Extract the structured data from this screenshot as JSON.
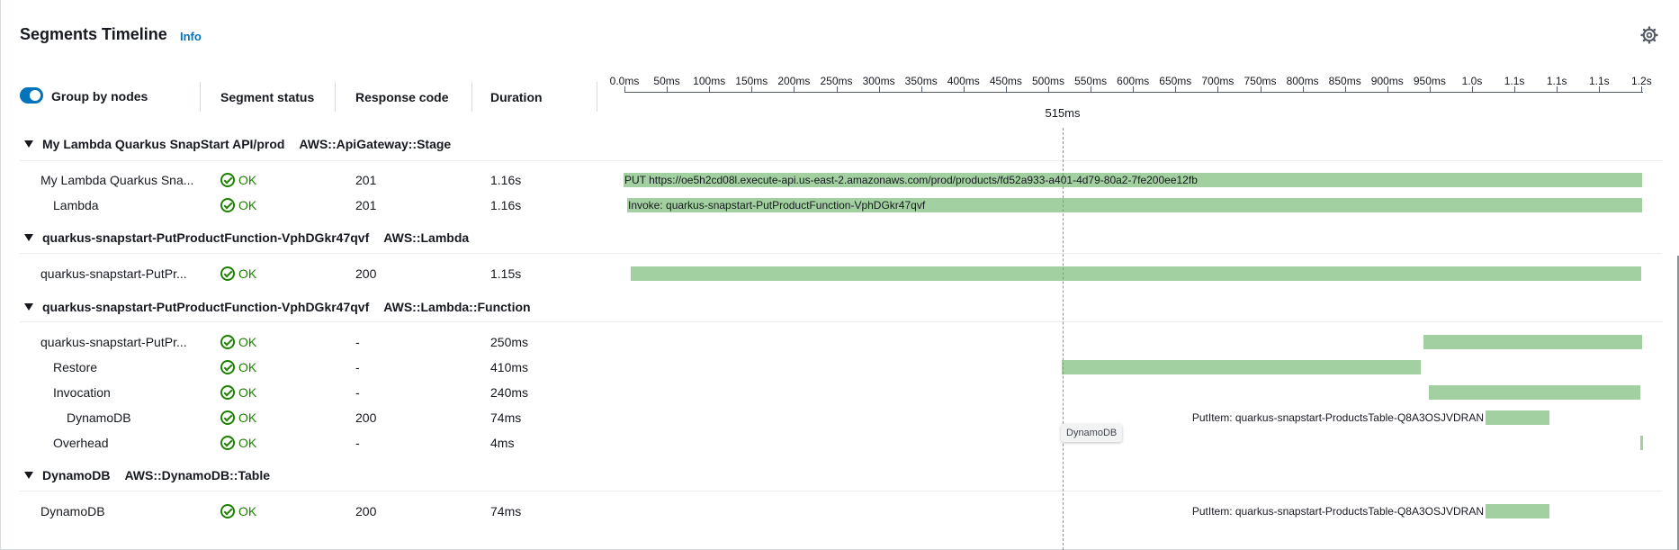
{
  "panel": {
    "title": "Segments Timeline",
    "info_label": "Info",
    "settings_icon": "gear-icon"
  },
  "controls": {
    "group_by_nodes_label": "Group by nodes",
    "group_by_nodes_enabled": true
  },
  "columns": {
    "status": "Segment status",
    "response_code": "Response code",
    "duration": "Duration"
  },
  "axis": {
    "ticks": [
      "0.0ms",
      "50ms",
      "100ms",
      "150ms",
      "200ms",
      "250ms",
      "300ms",
      "350ms",
      "400ms",
      "450ms",
      "500ms",
      "550ms",
      "600ms",
      "650ms",
      "700ms",
      "750ms",
      "800ms",
      "850ms",
      "900ms",
      "950ms",
      "1.0s",
      "1.1s",
      "1.1s",
      "1.1s",
      "1.2s"
    ],
    "cursor_label": "515ms"
  },
  "groups": [
    {
      "name": "My Lambda Quarkus SnapStart API/prod",
      "type": "AWS::ApiGateway::Stage",
      "rows": [
        {
          "name": "My Lambda Quarkus Sna...",
          "status": "OK",
          "code": "201",
          "duration": "1.16s",
          "bar_label": "PUT https://oe5h2cd08l.execute-api.us-east-2.amazonaws.com/prod/products/fd52a933-a401-4d79-80a2-7fe200ee12fb"
        },
        {
          "name": "Lambda",
          "status": "OK",
          "code": "201",
          "duration": "1.16s",
          "bar_label": "Invoke: quarkus-snapstart-PutProductFunction-VphDGkr47qvf"
        }
      ]
    },
    {
      "name": "quarkus-snapstart-PutProductFunction-VphDGkr47qvf",
      "type": "AWS::Lambda",
      "rows": [
        {
          "name": "quarkus-snapstart-PutPr...",
          "status": "OK",
          "code": "200",
          "duration": "1.15s",
          "bar_label": ""
        }
      ]
    },
    {
      "name": "quarkus-snapstart-PutProductFunction-VphDGkr47qvf",
      "type": "AWS::Lambda::Function",
      "rows": [
        {
          "name": "quarkus-snapstart-PutPr...",
          "status": "OK",
          "code": "-",
          "duration": "250ms",
          "bar_label": ""
        },
        {
          "name": "Restore",
          "status": "OK",
          "code": "-",
          "duration": "410ms",
          "bar_label": ""
        },
        {
          "name": "Invocation",
          "status": "OK",
          "code": "-",
          "duration": "240ms",
          "bar_label": ""
        },
        {
          "name": "DynamoDB",
          "status": "OK",
          "code": "200",
          "duration": "74ms",
          "bar_label": "PutItem: quarkus-snapstart-ProductsTable-Q8A3OSJVDRAN"
        },
        {
          "name": "Overhead",
          "status": "OK",
          "code": "-",
          "duration": "4ms",
          "bar_label": ""
        }
      ]
    },
    {
      "name": "DynamoDB",
      "type": "AWS::DynamoDB::Table",
      "rows": [
        {
          "name": "DynamoDB",
          "status": "OK",
          "code": "200",
          "duration": "74ms",
          "bar_label": "PutItem: quarkus-snapstart-ProductsTable-Q8A3OSJVDRAN"
        }
      ]
    }
  ],
  "tooltip": "DynamoDB",
  "colors": {
    "bar": "#a3d0a0",
    "status_ok": "#1d8102",
    "link": "#0073bb"
  }
}
